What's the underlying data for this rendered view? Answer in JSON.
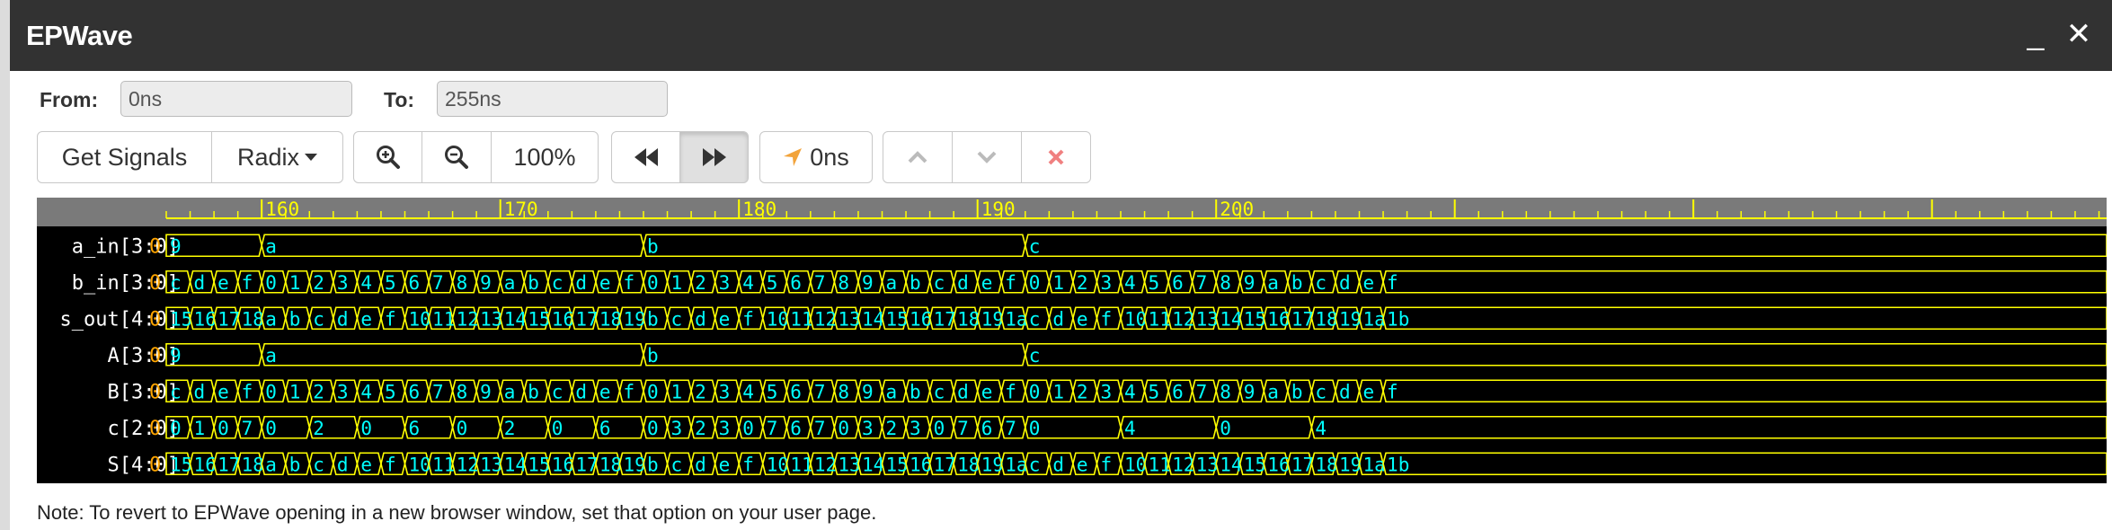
{
  "window": {
    "title": "EPWave",
    "minimize_icon": "_",
    "close_icon": "✕"
  },
  "range": {
    "from_label": "From:",
    "from_value": "0ns",
    "to_label": "To:",
    "to_value": "255ns"
  },
  "toolbar": {
    "get_signals": "Get Signals",
    "radix": "Radix",
    "zoom_level": "100%",
    "cursor_time": "0ns"
  },
  "ruler": {
    "labels": [
      "160",
      "170",
      "180",
      "190",
      "200"
    ],
    "visible_range": [
      156,
      207
    ]
  },
  "signals": [
    {
      "name": "a_in[3:0]",
      "value": "0",
      "changes": [
        [
          156,
          "9"
        ],
        [
          160,
          "a"
        ],
        [
          176,
          "b"
        ],
        [
          192,
          "c"
        ]
      ]
    },
    {
      "name": "b_in[3:0]",
      "value": "0",
      "changes": [
        [
          156,
          "c"
        ],
        [
          157,
          "d"
        ],
        [
          158,
          "e"
        ],
        [
          159,
          "f"
        ],
        [
          160,
          "0"
        ],
        [
          161,
          "1"
        ],
        [
          162,
          "2"
        ],
        [
          163,
          "3"
        ],
        [
          164,
          "4"
        ],
        [
          165,
          "5"
        ],
        [
          166,
          "6"
        ],
        [
          167,
          "7"
        ],
        [
          168,
          "8"
        ],
        [
          169,
          "9"
        ],
        [
          170,
          "a"
        ],
        [
          171,
          "b"
        ],
        [
          172,
          "c"
        ],
        [
          173,
          "d"
        ],
        [
          174,
          "e"
        ],
        [
          175,
          "f"
        ],
        [
          176,
          "0"
        ],
        [
          177,
          "1"
        ],
        [
          178,
          "2"
        ],
        [
          179,
          "3"
        ],
        [
          180,
          "4"
        ],
        [
          181,
          "5"
        ],
        [
          182,
          "6"
        ],
        [
          183,
          "7"
        ],
        [
          184,
          "8"
        ],
        [
          185,
          "9"
        ],
        [
          186,
          "a"
        ],
        [
          187,
          "b"
        ],
        [
          188,
          "c"
        ],
        [
          189,
          "d"
        ],
        [
          190,
          "e"
        ],
        [
          191,
          "f"
        ],
        [
          192,
          "0"
        ],
        [
          193,
          "1"
        ],
        [
          194,
          "2"
        ],
        [
          195,
          "3"
        ],
        [
          196,
          "4"
        ],
        [
          197,
          "5"
        ],
        [
          198,
          "6"
        ],
        [
          199,
          "7"
        ],
        [
          200,
          "8"
        ],
        [
          201,
          "9"
        ],
        [
          202,
          "a"
        ],
        [
          203,
          "b"
        ],
        [
          204,
          "c"
        ],
        [
          205,
          "d"
        ],
        [
          206,
          "e"
        ],
        [
          207,
          "f"
        ]
      ]
    },
    {
      "name": "s_out[4:0]",
      "value": "0",
      "changes": [
        [
          156,
          "15"
        ],
        [
          157,
          "16"
        ],
        [
          158,
          "17"
        ],
        [
          159,
          "18"
        ],
        [
          160,
          "a"
        ],
        [
          161,
          "b"
        ],
        [
          162,
          "c"
        ],
        [
          163,
          "d"
        ],
        [
          164,
          "e"
        ],
        [
          165,
          "f"
        ],
        [
          166,
          "10"
        ],
        [
          167,
          "11"
        ],
        [
          168,
          "12"
        ],
        [
          169,
          "13"
        ],
        [
          170,
          "14"
        ],
        [
          171,
          "15"
        ],
        [
          172,
          "16"
        ],
        [
          173,
          "17"
        ],
        [
          174,
          "18"
        ],
        [
          175,
          "19"
        ],
        [
          176,
          "b"
        ],
        [
          177,
          "c"
        ],
        [
          178,
          "d"
        ],
        [
          179,
          "e"
        ],
        [
          180,
          "f"
        ],
        [
          181,
          "10"
        ],
        [
          182,
          "11"
        ],
        [
          183,
          "12"
        ],
        [
          184,
          "13"
        ],
        [
          185,
          "14"
        ],
        [
          186,
          "15"
        ],
        [
          187,
          "16"
        ],
        [
          188,
          "17"
        ],
        [
          189,
          "18"
        ],
        [
          190,
          "19"
        ],
        [
          191,
          "1a"
        ],
        [
          192,
          "c"
        ],
        [
          193,
          "d"
        ],
        [
          194,
          "e"
        ],
        [
          195,
          "f"
        ],
        [
          196,
          "10"
        ],
        [
          197,
          "11"
        ],
        [
          198,
          "12"
        ],
        [
          199,
          "13"
        ],
        [
          200,
          "14"
        ],
        [
          201,
          "15"
        ],
        [
          202,
          "16"
        ],
        [
          203,
          "17"
        ],
        [
          204,
          "18"
        ],
        [
          205,
          "19"
        ],
        [
          206,
          "1a"
        ],
        [
          207,
          "1b"
        ]
      ]
    },
    {
      "name": "A[3:0]",
      "value": "0",
      "changes": [
        [
          156,
          "9"
        ],
        [
          160,
          "a"
        ],
        [
          176,
          "b"
        ],
        [
          192,
          "c"
        ]
      ]
    },
    {
      "name": "B[3:0]",
      "value": "0",
      "changes": [
        [
          156,
          "c"
        ],
        [
          157,
          "d"
        ],
        [
          158,
          "e"
        ],
        [
          159,
          "f"
        ],
        [
          160,
          "0"
        ],
        [
          161,
          "1"
        ],
        [
          162,
          "2"
        ],
        [
          163,
          "3"
        ],
        [
          164,
          "4"
        ],
        [
          165,
          "5"
        ],
        [
          166,
          "6"
        ],
        [
          167,
          "7"
        ],
        [
          168,
          "8"
        ],
        [
          169,
          "9"
        ],
        [
          170,
          "a"
        ],
        [
          171,
          "b"
        ],
        [
          172,
          "c"
        ],
        [
          173,
          "d"
        ],
        [
          174,
          "e"
        ],
        [
          175,
          "f"
        ],
        [
          176,
          "0"
        ],
        [
          177,
          "1"
        ],
        [
          178,
          "2"
        ],
        [
          179,
          "3"
        ],
        [
          180,
          "4"
        ],
        [
          181,
          "5"
        ],
        [
          182,
          "6"
        ],
        [
          183,
          "7"
        ],
        [
          184,
          "8"
        ],
        [
          185,
          "9"
        ],
        [
          186,
          "a"
        ],
        [
          187,
          "b"
        ],
        [
          188,
          "c"
        ],
        [
          189,
          "d"
        ],
        [
          190,
          "e"
        ],
        [
          191,
          "f"
        ],
        [
          192,
          "0"
        ],
        [
          193,
          "1"
        ],
        [
          194,
          "2"
        ],
        [
          195,
          "3"
        ],
        [
          196,
          "4"
        ],
        [
          197,
          "5"
        ],
        [
          198,
          "6"
        ],
        [
          199,
          "7"
        ],
        [
          200,
          "8"
        ],
        [
          201,
          "9"
        ],
        [
          202,
          "a"
        ],
        [
          203,
          "b"
        ],
        [
          204,
          "c"
        ],
        [
          205,
          "d"
        ],
        [
          206,
          "e"
        ],
        [
          207,
          "f"
        ]
      ]
    },
    {
      "name": "c[2:0]",
      "value": "0",
      "changes": [
        [
          156,
          "0"
        ],
        [
          157,
          "1"
        ],
        [
          158,
          "0"
        ],
        [
          159,
          "7"
        ],
        [
          160,
          "0"
        ],
        [
          162,
          "2"
        ],
        [
          164,
          "0"
        ],
        [
          166,
          "6"
        ],
        [
          168,
          "0"
        ],
        [
          170,
          "2"
        ],
        [
          172,
          "0"
        ],
        [
          174,
          "6"
        ],
        [
          176,
          "0"
        ],
        [
          177,
          "3"
        ],
        [
          178,
          "2"
        ],
        [
          179,
          "3"
        ],
        [
          180,
          "0"
        ],
        [
          181,
          "7"
        ],
        [
          182,
          "6"
        ],
        [
          183,
          "7"
        ],
        [
          184,
          "0"
        ],
        [
          185,
          "3"
        ],
        [
          186,
          "2"
        ],
        [
          187,
          "3"
        ],
        [
          188,
          "0"
        ],
        [
          189,
          "7"
        ],
        [
          190,
          "6"
        ],
        [
          191,
          "7"
        ],
        [
          192,
          "0"
        ],
        [
          196,
          "4"
        ],
        [
          200,
          "0"
        ],
        [
          204,
          "4"
        ]
      ]
    },
    {
      "name": "S[4:0]",
      "value": "0",
      "changes": [
        [
          156,
          "15"
        ],
        [
          157,
          "16"
        ],
        [
          158,
          "17"
        ],
        [
          159,
          "18"
        ],
        [
          160,
          "a"
        ],
        [
          161,
          "b"
        ],
        [
          162,
          "c"
        ],
        [
          163,
          "d"
        ],
        [
          164,
          "e"
        ],
        [
          165,
          "f"
        ],
        [
          166,
          "10"
        ],
        [
          167,
          "11"
        ],
        [
          168,
          "12"
        ],
        [
          169,
          "13"
        ],
        [
          170,
          "14"
        ],
        [
          171,
          "15"
        ],
        [
          172,
          "16"
        ],
        [
          173,
          "17"
        ],
        [
          174,
          "18"
        ],
        [
          175,
          "19"
        ],
        [
          176,
          "b"
        ],
        [
          177,
          "c"
        ],
        [
          178,
          "d"
        ],
        [
          179,
          "e"
        ],
        [
          180,
          "f"
        ],
        [
          181,
          "10"
        ],
        [
          182,
          "11"
        ],
        [
          183,
          "12"
        ],
        [
          184,
          "13"
        ],
        [
          185,
          "14"
        ],
        [
          186,
          "15"
        ],
        [
          187,
          "16"
        ],
        [
          188,
          "17"
        ],
        [
          189,
          "18"
        ],
        [
          190,
          "19"
        ],
        [
          191,
          "1a"
        ],
        [
          192,
          "c"
        ],
        [
          193,
          "d"
        ],
        [
          194,
          "e"
        ],
        [
          195,
          "f"
        ],
        [
          196,
          "10"
        ],
        [
          197,
          "11"
        ],
        [
          198,
          "12"
        ],
        [
          199,
          "13"
        ],
        [
          200,
          "14"
        ],
        [
          201,
          "15"
        ],
        [
          202,
          "16"
        ],
        [
          203,
          "17"
        ],
        [
          204,
          "18"
        ],
        [
          205,
          "19"
        ],
        [
          206,
          "1a"
        ],
        [
          207,
          "1b"
        ]
      ]
    }
  ],
  "colors": {
    "wave": "#ffff00",
    "wave_text": "#00ffff",
    "signal_name": "#ffffff",
    "initial_value": "#ffa500",
    "ruler_text": "#ffff00"
  },
  "note": "Note: To revert to EPWave opening in a new browser window, set that option on your user page."
}
